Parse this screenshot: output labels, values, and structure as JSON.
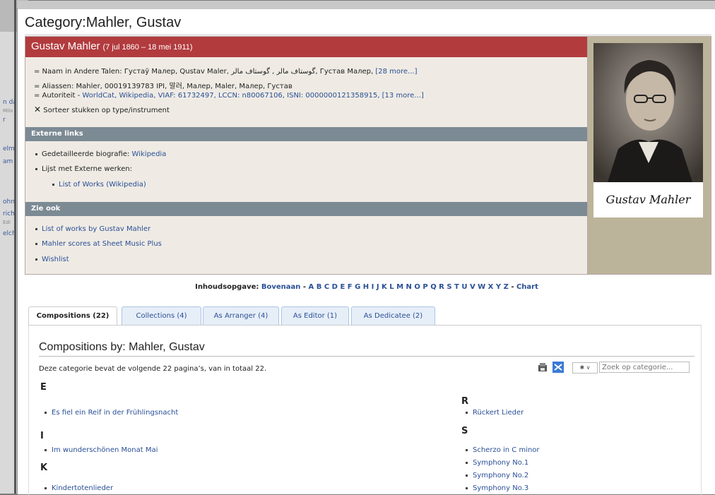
{
  "background_window": {
    "fragments": [
      "n da",
      "Mila",
      "r",
      "elm",
      "am",
      "ohn",
      "rich",
      "Edi",
      "elch"
    ]
  },
  "page": {
    "title": "Category:Mahler, Gustav"
  },
  "composer": {
    "name": "Gustav Mahler",
    "dates": "(7 jul 1860 – 18 mei 1911)",
    "other_names_label": "= Naam in Andere Talen: ",
    "other_names": "Густаў Малер, Qustav Maler, گوستاف مالر , گوستاف مالر, Густав Малер, ",
    "other_names_more": "[28 more...]",
    "aliases": "= Aliassen: Mahler, 00019139783 IPI, 말러, Малер, Maler, Малер, Густав",
    "authority_label": "= Autoriteit - ",
    "authority_links": "WorldCat, Wikipedia, VIAF: 61732497, LCCN: n80067106, ISNI: 0000000121358915, [13 more...]",
    "sort_label": "Sorteer stukken op type/instrument",
    "external_heading": "Externe links",
    "bio_label": "Gedetailleerde biografie: ",
    "bio_link": "Wikipedia",
    "external_works_label": "Lijst met Externe werken:",
    "external_works_link": "List of Works (Wikipedia)",
    "see_also_heading": "Zie ook",
    "see_also": [
      "List of works by Gustav Mahler",
      "Mahler scores at Sheet Music Plus",
      "Wishlist"
    ],
    "signature": "Gustav Mahler"
  },
  "index": {
    "label": "Inhoudsopgave: ",
    "top": "Bovenaan",
    "letters": "A B C D E F G H I J K L M N O P Q R S T U V W X Y Z",
    "chart": "Chart"
  },
  "tabs": [
    {
      "label": "Compositions (22)"
    },
    {
      "label": "Collections (4)"
    },
    {
      "label": "As Arranger (4)"
    },
    {
      "label": "As Editor (1)"
    },
    {
      "label": "As Dedicatee (2)"
    }
  ],
  "compositions": {
    "title": "Compositions by: Mahler, Gustav",
    "description": "Deze categorie bevat de volgende 22 pagina’s, van in totaal 22.",
    "search_placeholder": "Zoek op categorie...",
    "select_value": "✱ ∨",
    "left": [
      {
        "letter": "E",
        "items": [
          "Es fiel ein Reif in der Frühlingsnacht"
        ]
      },
      {
        "letter": "I",
        "items": [
          "Im wunderschönen Monat Mai"
        ]
      },
      {
        "letter": "K",
        "items": [
          "Kindertotenlieder"
        ]
      }
    ],
    "right": [
      {
        "letter": "R",
        "items": [
          "Rückert Lieder"
        ]
      },
      {
        "letter": "S",
        "items": [
          "Scherzo in C minor",
          "Symphony No.1",
          "Symphony No.2",
          "Symphony No.3"
        ]
      }
    ]
  },
  "colors": {
    "header_red": "#b23b3e",
    "section_gray": "#7c8a94",
    "link_blue": "#2a4f96",
    "box_bg": "#efebe4"
  }
}
